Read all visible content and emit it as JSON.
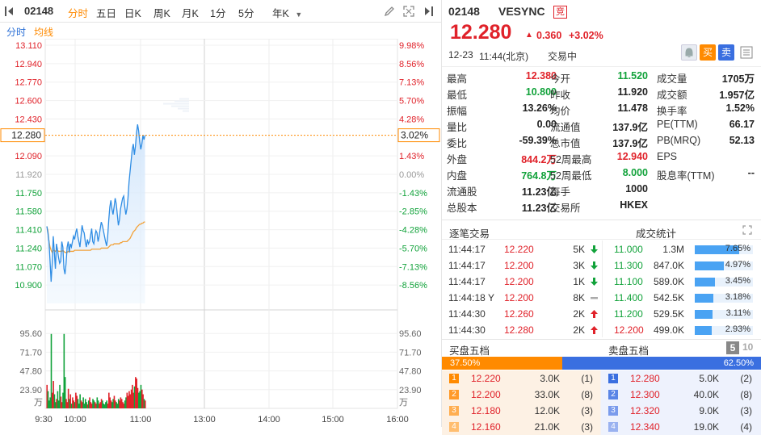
{
  "toolbar": {
    "code": "02148",
    "tabs": [
      "分时",
      "五日",
      "日K",
      "周K",
      "月K",
      "1分",
      "5分",
      "年K"
    ],
    "active_tab": "分时",
    "dropdown": "年K"
  },
  "subtabs": {
    "label1": "分时",
    "label2": "均线"
  },
  "header": {
    "code": "02148",
    "name": "VESYNC",
    "badge": "竞",
    "price": "12.280",
    "change": "0.360",
    "change_pct": "+3.02%",
    "date": "12-23",
    "time": "11:44(北京)",
    "status": "交易中",
    "buy_btn": "买",
    "sell_btn": "卖"
  },
  "stats": [
    {
      "l1": "最高",
      "v1": "12.380",
      "c1": "red",
      "l2": "今开",
      "v2": "11.520",
      "c2": "green",
      "l3": "成交量",
      "v3": "1705万",
      "c3": "black"
    },
    {
      "l1": "最低",
      "v1": "10.800",
      "c1": "green",
      "l2": "昨收",
      "v2": "11.920",
      "c2": "black",
      "l3": "成交额",
      "v3": "1.957亿",
      "c3": "black"
    },
    {
      "l1": "振幅",
      "v1": "13.26%",
      "c1": "black",
      "l2": "均价",
      "v2": "11.478",
      "c2": "black",
      "l3": "换手率",
      "v3": "1.52%",
      "c3": "black"
    },
    {
      "l1": "量比",
      "v1": "0.00",
      "c1": "black",
      "l2": "流通值",
      "v2": "137.9亿",
      "c2": "black",
      "l3": "PE(TTM)",
      "v3": "66.17",
      "c3": "black"
    },
    {
      "l1": "委比",
      "v1": "-59.39%",
      "c1": "black",
      "l2": "总市值",
      "v2": "137.9亿",
      "c2": "black",
      "l3": "PB(MRQ)",
      "v3": "52.13",
      "c3": "black"
    },
    {
      "l1": "外盘",
      "v1": "844.2万",
      "c1": "red",
      "l2": "52周最高",
      "v2": "12.940",
      "c2": "red",
      "l3": "EPS",
      "v3": "",
      "c3": "black"
    },
    {
      "l1": "内盘",
      "v1": "764.8万",
      "c1": "green",
      "l2": "52周最低",
      "v2": "8.000",
      "c2": "green",
      "l3": "股息率(TTM)",
      "v3": "--",
      "c3": "black"
    },
    {
      "l1": "流通股",
      "v1": "11.23亿",
      "c1": "black",
      "l2": "每手",
      "v2": "1000",
      "c2": "black",
      "l3": "",
      "v3": "",
      "c3": "black"
    },
    {
      "l1": "总股本",
      "v1": "11.23亿",
      "c1": "black",
      "l2": "交易所",
      "v2": "HKEX",
      "c2": "black",
      "l3": "",
      "v3": "",
      "c3": "black"
    }
  ],
  "trades_title": "逐笔交易",
  "trades": [
    {
      "time": "11:44:17",
      "price": "12.220",
      "vol": "5K",
      "dir": "down"
    },
    {
      "time": "11:44:17",
      "price": "12.200",
      "vol": "3K",
      "dir": "down"
    },
    {
      "time": "11:44:17",
      "price": "12.200",
      "vol": "1K",
      "dir": "down"
    },
    {
      "time": "11:44:18 Y",
      "price": "12.200",
      "vol": "8K",
      "dir": "flat"
    },
    {
      "time": "11:44:30",
      "price": "12.260",
      "vol": "2K",
      "dir": "up"
    },
    {
      "time": "11:44:30",
      "price": "12.280",
      "vol": "2K",
      "dir": "up"
    }
  ],
  "volstat_title": "成交统计",
  "volstats": [
    {
      "price": "11.000",
      "vol": "1.3M",
      "pct": "7.65%",
      "frac": 0.765
    },
    {
      "price": "11.300",
      "vol": "847.0K",
      "pct": "4.97%",
      "frac": 0.497
    },
    {
      "price": "11.100",
      "vol": "589.0K",
      "pct": "3.45%",
      "frac": 0.345
    },
    {
      "price": "11.400",
      "vol": "542.5K",
      "pct": "3.18%",
      "frac": 0.318
    },
    {
      "price": "11.200",
      "vol": "529.5K",
      "pct": "3.11%",
      "frac": 0.311
    },
    {
      "price": "12.200",
      "vol": "499.0K",
      "pct": "2.93%",
      "frac": 0.293
    }
  ],
  "orderbook": {
    "buy_title": "买盘五档",
    "sell_title": "卖盘五档",
    "levels5": "5",
    "levels10": "10",
    "buy_pct": "37.50%",
    "sell_pct": "62.50%",
    "buy_frac": 0.375,
    "buys": [
      {
        "n": "1",
        "price": "12.220",
        "vol": "3.0K",
        "cnt": "(1)"
      },
      {
        "n": "2",
        "price": "12.200",
        "vol": "33.0K",
        "cnt": "(8)"
      },
      {
        "n": "3",
        "price": "12.180",
        "vol": "12.0K",
        "cnt": "(3)"
      },
      {
        "n": "4",
        "price": "12.160",
        "vol": "21.0K",
        "cnt": "(3)"
      }
    ],
    "sells": [
      {
        "n": "1",
        "price": "12.280",
        "vol": "5.0K",
        "cnt": "(2)"
      },
      {
        "n": "2",
        "price": "12.300",
        "vol": "40.0K",
        "cnt": "(8)"
      },
      {
        "n": "3",
        "price": "12.320",
        "vol": "9.0K",
        "cnt": "(3)"
      },
      {
        "n": "4",
        "price": "12.340",
        "vol": "19.0K",
        "cnt": "(4)"
      }
    ]
  },
  "colors": {
    "up": "#e0222a",
    "down": "#11a23a",
    "accent": "#ff8a00",
    "blue": "#4aa3f3",
    "avg": "#f2a23a"
  },
  "chart_data": {
    "type": "line",
    "price_ticks": [
      "13.110",
      "12.940",
      "12.770",
      "12.600",
      "12.430",
      "12.280",
      "12.090",
      "11.920",
      "11.750",
      "11.580",
      "11.410",
      "11.240",
      "11.070",
      "10.900"
    ],
    "pct_ticks": [
      "9.98%",
      "8.56%",
      "7.13%",
      "5.70%",
      "4.28%",
      "3.02%",
      "1.43%",
      "0.00%",
      "-1.43%",
      "-2.85%",
      "-4.28%",
      "-5.70%",
      "-7.13%",
      "-8.56%"
    ],
    "current_price": "12.280",
    "current_pct": "3.02%",
    "vol_ticks": [
      "95.60",
      "71.70",
      "47.80",
      "23.90"
    ],
    "vol_unit": "万",
    "x_ticks": [
      "9:30",
      "10:00",
      "11:00",
      "13:00",
      "14:00",
      "15:00",
      "16:00"
    ],
    "ylim": [
      10.73,
      13.11
    ],
    "prev_close": 11.92,
    "price_series": [
      11.44,
      11.38,
      11.3,
      11.12,
      10.93,
      11.1,
      11.35,
      11.2,
      11.05,
      11.28,
      11.22,
      11.15,
      11.1,
      11.12,
      11.3,
      11.25,
      11.05,
      11.0,
      11.1,
      11.25,
      11.3,
      11.2,
      11.28,
      11.25,
      11.3,
      11.35,
      11.32,
      11.38,
      11.42,
      11.35,
      11.3,
      11.25,
      11.35,
      11.45,
      11.4,
      11.38,
      11.3,
      11.25,
      11.32,
      11.28,
      11.3,
      11.36,
      11.42,
      11.3,
      11.28,
      11.35,
      11.4,
      11.38,
      11.3,
      11.35,
      11.42,
      11.48,
      11.45,
      11.4,
      11.35,
      11.3,
      11.26,
      11.35,
      11.5,
      11.62,
      11.68,
      11.6,
      11.55,
      11.62,
      11.7,
      11.65,
      11.55,
      11.45,
      11.5,
      11.6,
      11.65,
      11.7,
      11.72,
      11.62,
      11.55,
      11.6,
      11.7,
      11.85,
      11.95,
      12.05,
      12.15,
      12.2,
      12.1,
      12.18,
      12.3,
      12.38,
      12.32,
      12.22,
      12.15,
      12.2,
      12.28,
      12.24,
      12.28
    ],
    "avg_series": [
      11.44,
      11.4,
      11.3,
      11.25,
      11.22,
      11.2,
      11.22,
      11.22,
      11.21,
      11.22,
      11.22,
      11.21,
      11.21,
      11.21,
      11.21,
      11.22,
      11.21,
      11.2,
      11.2,
      11.2,
      11.21,
      11.21,
      11.21,
      11.21,
      11.21,
      11.21,
      11.22,
      11.22,
      11.22,
      11.22,
      11.22,
      11.22,
      11.22,
      11.22,
      11.22,
      11.22,
      11.22,
      11.22,
      11.22,
      11.22,
      11.22,
      11.22,
      11.23,
      11.23,
      11.23,
      11.23,
      11.23,
      11.23,
      11.23,
      11.23,
      11.23,
      11.24,
      11.24,
      11.24,
      11.24,
      11.24,
      11.24,
      11.24,
      11.25,
      11.26,
      11.27,
      11.27,
      11.27,
      11.28,
      11.28,
      11.28,
      11.28,
      11.28,
      11.28,
      11.29,
      11.29,
      11.3,
      11.3,
      11.3,
      11.3,
      11.3,
      11.31,
      11.32,
      11.33,
      11.35,
      11.37,
      11.39,
      11.4,
      11.41,
      11.43,
      11.44,
      11.45,
      11.46,
      11.46,
      11.47,
      11.47,
      11.48,
      11.48
    ],
    "volume_series": [
      30,
      22,
      10,
      14,
      95,
      20,
      35,
      18,
      8,
      12,
      22,
      10,
      30,
      15,
      8,
      20,
      95,
      40,
      12,
      8,
      25,
      12,
      18,
      6,
      14,
      10,
      8,
      20,
      16,
      12,
      6,
      18,
      10,
      8,
      14,
      6,
      12,
      8,
      5,
      10,
      14,
      8,
      6,
      12,
      10,
      8,
      6,
      14,
      10,
      6,
      8,
      12,
      10,
      6,
      5,
      8,
      10,
      6,
      20,
      14,
      10,
      8,
      12,
      16,
      10,
      8,
      6,
      12,
      10,
      14,
      12,
      8,
      6,
      10,
      14,
      20,
      16,
      22,
      18,
      24,
      30,
      20,
      28,
      40,
      38,
      26,
      20,
      22,
      30,
      24,
      18,
      12,
      10
    ],
    "max_points": 330,
    "vol_max": 119.5
  }
}
